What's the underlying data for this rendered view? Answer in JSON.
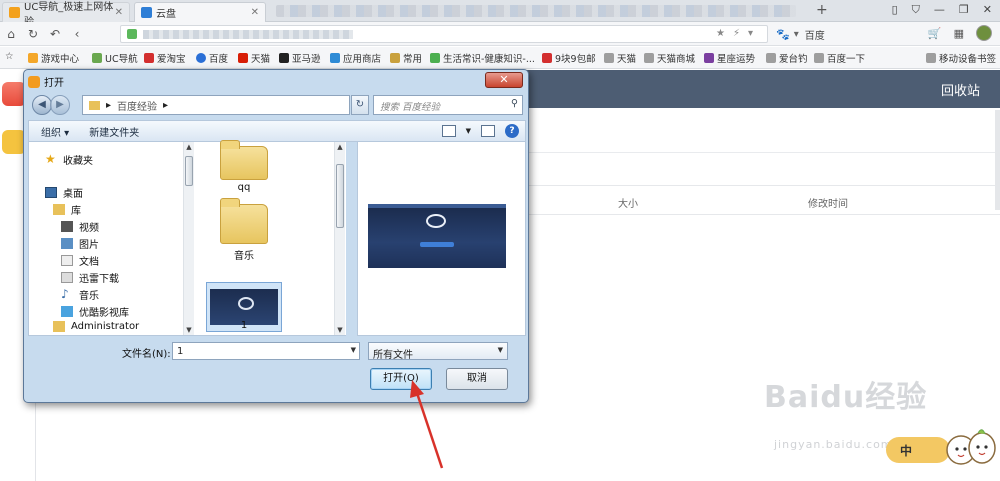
{
  "browser": {
    "tabs": [
      {
        "label": "UC导航_极速上网体验",
        "active": false
      },
      {
        "label": "云盘",
        "active": true
      }
    ],
    "search_engine_label": "百度",
    "bookmarks": [
      "游戏中心",
      "UC导航",
      "爱淘宝",
      "百度",
      "天猫",
      "亚马逊",
      "应用商店",
      "常用",
      "生活常识-健康知识-...",
      "9块9包邮",
      "天猫",
      "天猫商城",
      "星座运势",
      "爱台钓",
      "百度一下",
      "移动设备书签"
    ]
  },
  "page": {
    "header_right": "回收站",
    "columns": {
      "size": "大小",
      "modified": "修改时间"
    },
    "upload_button": "中"
  },
  "dialog": {
    "title": "打开",
    "path": "百度经验",
    "search_placeholder": "搜索 百度经验",
    "toolbar": {
      "organize": "组织 ▾",
      "new_folder": "新建文件夹"
    },
    "nav_items": [
      {
        "label": "收藏夹",
        "icon": "star-icon"
      },
      {
        "label": "桌面",
        "icon": "desktop-icon"
      },
      {
        "label": "库",
        "icon": "library-icon"
      },
      {
        "label": "视频",
        "icon": "video-icon"
      },
      {
        "label": "图片",
        "icon": "picture-icon"
      },
      {
        "label": "文档",
        "icon": "document-icon"
      },
      {
        "label": "迅雷下载",
        "icon": "download-icon"
      },
      {
        "label": "音乐",
        "icon": "music-icon"
      },
      {
        "label": "优酷影视库",
        "icon": "video-library-icon"
      },
      {
        "label": "Administrator",
        "icon": "user-folder-icon"
      }
    ],
    "files": [
      {
        "label": "qq"
      },
      {
        "label": "音乐"
      },
      {
        "label": "1"
      }
    ],
    "filename_label": "文件名(N):",
    "filename_value": "1",
    "filetype_value": "所有文件",
    "open_button": "打开(O)",
    "cancel_button": "取消"
  },
  "watermark": {
    "brand": "Baidu经验",
    "url": "jingyan.baidu.com"
  },
  "colors": {
    "page_header": "#4d5d73",
    "dialog_frame": "#c7dbee",
    "arrow": "#d8322a",
    "upload_button": "#f3c863"
  }
}
